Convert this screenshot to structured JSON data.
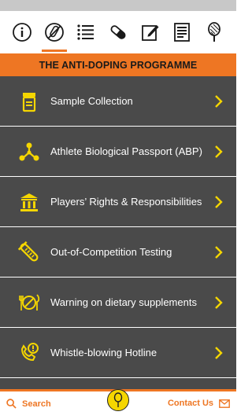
{
  "colors": {
    "accent": "#ee7623",
    "icon_yellow": "#f5d600",
    "menu_bg": "#4a4a4a"
  },
  "top_nav": {
    "icons": [
      "info-icon",
      "no-drugs-icon",
      "list-icon",
      "pill-icon",
      "edit-icon",
      "document-icon",
      "racket-icon"
    ],
    "active": "no-drugs-icon"
  },
  "banner": {
    "title": "THE ANTI-DOPING PROGRAMME"
  },
  "menu": {
    "items": [
      {
        "label": "Sample Collection",
        "icon": "sample-jar-icon"
      },
      {
        "label": "Athlete Biological Passport (ABP)",
        "icon": "network-icon"
      },
      {
        "label": "Players’ Rights & Responsibilities",
        "icon": "institution-icon"
      },
      {
        "label": "Out-of-Competition Testing",
        "icon": "test-tube-icon"
      },
      {
        "label": "Warning on dietary supplements",
        "icon": "no-food-icon"
      },
      {
        "label": "Whistle-blowing Hotline",
        "icon": "alert-phone-icon"
      }
    ]
  },
  "bottom_bar": {
    "search_label": "Search",
    "contact_label": "Contact Us"
  }
}
